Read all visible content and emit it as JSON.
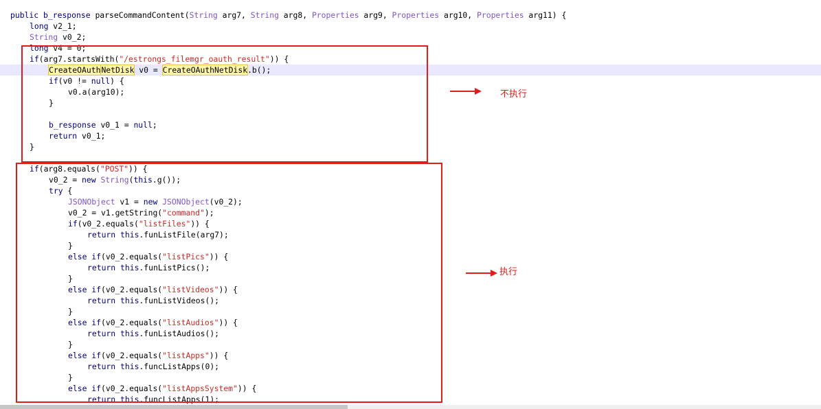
{
  "code_lines": [
    {
      "indent": 0,
      "segs": [
        {
          "t": "public ",
          "c": "kw"
        },
        {
          "t": "b_response ",
          "c": "kw"
        },
        {
          "t": "parseCommandContent(",
          "c": "plain"
        },
        {
          "t": "String",
          "c": "type"
        },
        {
          "t": " arg7, ",
          "c": "plain"
        },
        {
          "t": "String",
          "c": "type"
        },
        {
          "t": " arg8, ",
          "c": "plain"
        },
        {
          "t": "Properties",
          "c": "type"
        },
        {
          "t": " arg9, ",
          "c": "plain"
        },
        {
          "t": "Properties",
          "c": "type"
        },
        {
          "t": " arg10, ",
          "c": "plain"
        },
        {
          "t": "Properties",
          "c": "type"
        },
        {
          "t": " arg11) {",
          "c": "plain"
        }
      ]
    },
    {
      "indent": 1,
      "segs": [
        {
          "t": "long ",
          "c": "kw"
        },
        {
          "t": "v2_1;",
          "c": "plain"
        }
      ]
    },
    {
      "indent": 1,
      "segs": [
        {
          "t": "String",
          "c": "type"
        },
        {
          "t": " v0_2;",
          "c": "plain"
        }
      ]
    },
    {
      "indent": 1,
      "segs": [
        {
          "t": "long ",
          "c": "kw"
        },
        {
          "t": "v4 = 0;",
          "c": "plain"
        }
      ]
    },
    {
      "indent": 1,
      "segs": [
        {
          "t": "if",
          "c": "kw"
        },
        {
          "t": "(arg7.startsWith(",
          "c": "plain"
        },
        {
          "t": "\"/estrongs_filemgr_oauth_result\"",
          "c": "str"
        },
        {
          "t": ")) {",
          "c": "plain"
        }
      ]
    },
    {
      "indent": 2,
      "highlight": true,
      "segs": [
        {
          "t": "CreateOAuth",
          "c": "mark"
        },
        {
          "t": "NetDisk",
          "c": "mark"
        },
        {
          "t": " v0 = ",
          "c": "plain"
        },
        {
          "t": "CreateOAuthNetDisk",
          "c": "mark"
        },
        {
          "t": ".b();",
          "c": "plain"
        }
      ]
    },
    {
      "indent": 2,
      "segs": [
        {
          "t": "if",
          "c": "kw"
        },
        {
          "t": "(v0 != ",
          "c": "plain"
        },
        {
          "t": "null",
          "c": "kw"
        },
        {
          "t": ") {",
          "c": "plain"
        }
      ]
    },
    {
      "indent": 3,
      "segs": [
        {
          "t": "v0.a(arg10);",
          "c": "plain"
        }
      ]
    },
    {
      "indent": 2,
      "segs": [
        {
          "t": "}",
          "c": "plain"
        }
      ]
    },
    {
      "indent": 0,
      "segs": []
    },
    {
      "indent": 2,
      "segs": [
        {
          "t": "b_response ",
          "c": "kw"
        },
        {
          "t": "v0_1 = ",
          "c": "plain"
        },
        {
          "t": "null",
          "c": "kw"
        },
        {
          "t": ";",
          "c": "plain"
        }
      ]
    },
    {
      "indent": 2,
      "segs": [
        {
          "t": "return ",
          "c": "kw"
        },
        {
          "t": "v0_1;",
          "c": "plain"
        }
      ]
    },
    {
      "indent": 1,
      "segs": [
        {
          "t": "}",
          "c": "plain"
        }
      ]
    },
    {
      "indent": 0,
      "segs": []
    },
    {
      "indent": 1,
      "segs": [
        {
          "t": "if",
          "c": "kw"
        },
        {
          "t": "(arg8.equals(",
          "c": "plain"
        },
        {
          "t": "\"POST\"",
          "c": "str"
        },
        {
          "t": ")) {",
          "c": "plain"
        }
      ]
    },
    {
      "indent": 2,
      "segs": [
        {
          "t": "v0_2 = ",
          "c": "plain"
        },
        {
          "t": "new ",
          "c": "kw"
        },
        {
          "t": "String",
          "c": "type"
        },
        {
          "t": "(",
          "c": "plain"
        },
        {
          "t": "this",
          "c": "kw"
        },
        {
          "t": ".g());",
          "c": "plain"
        }
      ]
    },
    {
      "indent": 2,
      "segs": [
        {
          "t": "try",
          "c": "kw"
        },
        {
          "t": " {",
          "c": "plain"
        }
      ]
    },
    {
      "indent": 3,
      "segs": [
        {
          "t": "JSONObject",
          "c": "type"
        },
        {
          "t": " v1 = ",
          "c": "plain"
        },
        {
          "t": "new ",
          "c": "kw"
        },
        {
          "t": "JSONObject",
          "c": "type"
        },
        {
          "t": "(v0_2);",
          "c": "plain"
        }
      ]
    },
    {
      "indent": 3,
      "segs": [
        {
          "t": "v0_2 = v1.getString(",
          "c": "plain"
        },
        {
          "t": "\"command\"",
          "c": "str"
        },
        {
          "t": ");",
          "c": "plain"
        }
      ]
    },
    {
      "indent": 3,
      "segs": [
        {
          "t": "if",
          "c": "kw"
        },
        {
          "t": "(v0_2.equals(",
          "c": "plain"
        },
        {
          "t": "\"listFiles\"",
          "c": "str"
        },
        {
          "t": ")) {",
          "c": "plain"
        }
      ]
    },
    {
      "indent": 4,
      "segs": [
        {
          "t": "return ",
          "c": "kw"
        },
        {
          "t": "this",
          "c": "kw"
        },
        {
          "t": ".funListFile(arg7);",
          "c": "plain"
        }
      ]
    },
    {
      "indent": 3,
      "segs": [
        {
          "t": "}",
          "c": "plain"
        }
      ]
    },
    {
      "indent": 3,
      "segs": [
        {
          "t": "else ",
          "c": "kw"
        },
        {
          "t": "if",
          "c": "kw"
        },
        {
          "t": "(v0_2.equals(",
          "c": "plain"
        },
        {
          "t": "\"listPics\"",
          "c": "str"
        },
        {
          "t": ")) {",
          "c": "plain"
        }
      ]
    },
    {
      "indent": 4,
      "segs": [
        {
          "t": "return ",
          "c": "kw"
        },
        {
          "t": "this",
          "c": "kw"
        },
        {
          "t": ".funListPics();",
          "c": "plain"
        }
      ]
    },
    {
      "indent": 3,
      "segs": [
        {
          "t": "}",
          "c": "plain"
        }
      ]
    },
    {
      "indent": 3,
      "segs": [
        {
          "t": "else ",
          "c": "kw"
        },
        {
          "t": "if",
          "c": "kw"
        },
        {
          "t": "(v0_2.equals(",
          "c": "plain"
        },
        {
          "t": "\"listVideos\"",
          "c": "str"
        },
        {
          "t": ")) {",
          "c": "plain"
        }
      ]
    },
    {
      "indent": 4,
      "segs": [
        {
          "t": "return ",
          "c": "kw"
        },
        {
          "t": "this",
          "c": "kw"
        },
        {
          "t": ".funListVideos();",
          "c": "plain"
        }
      ]
    },
    {
      "indent": 3,
      "segs": [
        {
          "t": "}",
          "c": "plain"
        }
      ]
    },
    {
      "indent": 3,
      "segs": [
        {
          "t": "else ",
          "c": "kw"
        },
        {
          "t": "if",
          "c": "kw"
        },
        {
          "t": "(v0_2.equals(",
          "c": "plain"
        },
        {
          "t": "\"listAudios\"",
          "c": "str"
        },
        {
          "t": ")) {",
          "c": "plain"
        }
      ]
    },
    {
      "indent": 4,
      "segs": [
        {
          "t": "return ",
          "c": "kw"
        },
        {
          "t": "this",
          "c": "kw"
        },
        {
          "t": ".funListAudios();",
          "c": "plain"
        }
      ]
    },
    {
      "indent": 3,
      "segs": [
        {
          "t": "}",
          "c": "plain"
        }
      ]
    },
    {
      "indent": 3,
      "segs": [
        {
          "t": "else ",
          "c": "kw"
        },
        {
          "t": "if",
          "c": "kw"
        },
        {
          "t": "(v0_2.equals(",
          "c": "plain"
        },
        {
          "t": "\"listApps\"",
          "c": "str"
        },
        {
          "t": ")) {",
          "c": "plain"
        }
      ]
    },
    {
      "indent": 4,
      "segs": [
        {
          "t": "return ",
          "c": "kw"
        },
        {
          "t": "this",
          "c": "kw"
        },
        {
          "t": ".funcListApps(0);",
          "c": "plain"
        }
      ]
    },
    {
      "indent": 3,
      "segs": [
        {
          "t": "}",
          "c": "plain"
        }
      ]
    },
    {
      "indent": 3,
      "segs": [
        {
          "t": "else ",
          "c": "kw"
        },
        {
          "t": "if",
          "c": "kw"
        },
        {
          "t": "(v0_2.equals(",
          "c": "plain"
        },
        {
          "t": "\"listAppsSystem\"",
          "c": "str"
        },
        {
          "t": ")) {",
          "c": "plain"
        }
      ]
    },
    {
      "indent": 4,
      "segs": [
        {
          "t": "return ",
          "c": "kw"
        },
        {
          "t": "this",
          "c": "kw"
        },
        {
          "t": ".funcListApps(1);",
          "c": "plain"
        }
      ]
    }
  ],
  "annotations": {
    "not_executed_label": "不执行",
    "executed_label": "执行"
  },
  "colors": {
    "keyword": "#000080",
    "type": "#7f55c8",
    "string": "#cc2929",
    "annotation_red": "#e21b1b",
    "line_highlight": "#e8e8ff",
    "search_match": "#fff6a8"
  }
}
